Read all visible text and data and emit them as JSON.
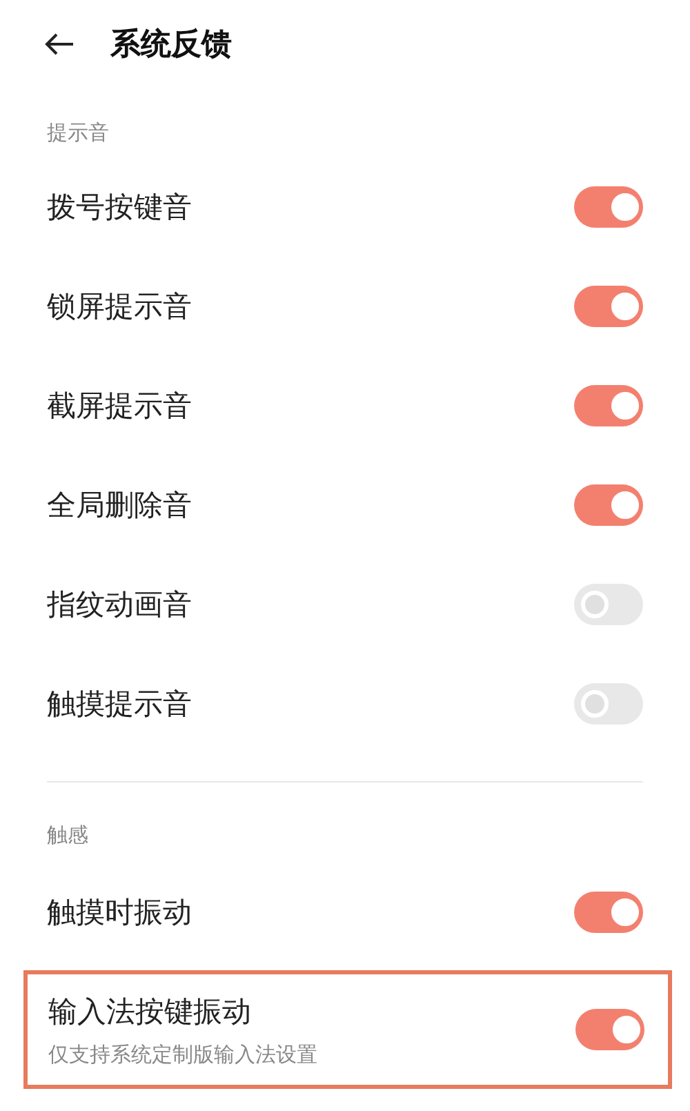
{
  "header": {
    "title": "系统反馈"
  },
  "sections": [
    {
      "title": "提示音",
      "items": [
        {
          "label": "拨号按键音",
          "on": true,
          "highlighted": false
        },
        {
          "label": "锁屏提示音",
          "on": true,
          "highlighted": false
        },
        {
          "label": "截屏提示音",
          "on": true,
          "highlighted": false
        },
        {
          "label": "全局删除音",
          "on": true,
          "highlighted": false
        },
        {
          "label": "指纹动画音",
          "on": false,
          "highlighted": false
        },
        {
          "label": "触摸提示音",
          "on": false,
          "highlighted": false
        }
      ]
    },
    {
      "title": "触感",
      "items": [
        {
          "label": "触摸时振动",
          "on": true,
          "highlighted": false
        },
        {
          "label": "输入法按键振动",
          "subtitle": "仅支持系统定制版输入法设置",
          "on": true,
          "highlighted": true
        }
      ]
    }
  ]
}
